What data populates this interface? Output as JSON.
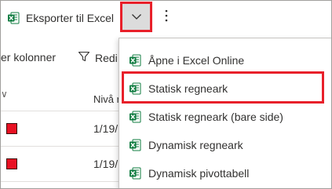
{
  "toolbar": {
    "export_label": "Eksporter til Excel",
    "dropdown_icon": "chevron-down-icon",
    "more_icon": "more-vertical-icon"
  },
  "secondary_toolbar": {
    "edit_columns_label": "er kolonner",
    "edit_filters_label": "Redi",
    "filter_icon": "filter-icon"
  },
  "grid": {
    "header_caret": "∨",
    "columns": [
      "Nivå r"
    ],
    "rows": [
      {
        "status_color": "#e81123",
        "date": "1/19/"
      },
      {
        "status_color": "#e81123",
        "date": "1/19/"
      }
    ]
  },
  "export_menu": {
    "items": [
      {
        "label": "Åpne i Excel Online",
        "icon": "excel-icon"
      },
      {
        "label": "Statisk regneark",
        "icon": "excel-icon"
      },
      {
        "label": "Statisk regneark (bare side)",
        "icon": "excel-icon"
      },
      {
        "label": "Dynamisk regneark",
        "icon": "excel-icon"
      },
      {
        "label": "Dynamisk pivottabell",
        "icon": "excel-icon"
      }
    ]
  },
  "colors": {
    "excel_green": "#107c41",
    "highlight_red": "#e8202a",
    "dropdown_pressed_bg": "#dcdcdc",
    "status_red": "#e81123"
  }
}
